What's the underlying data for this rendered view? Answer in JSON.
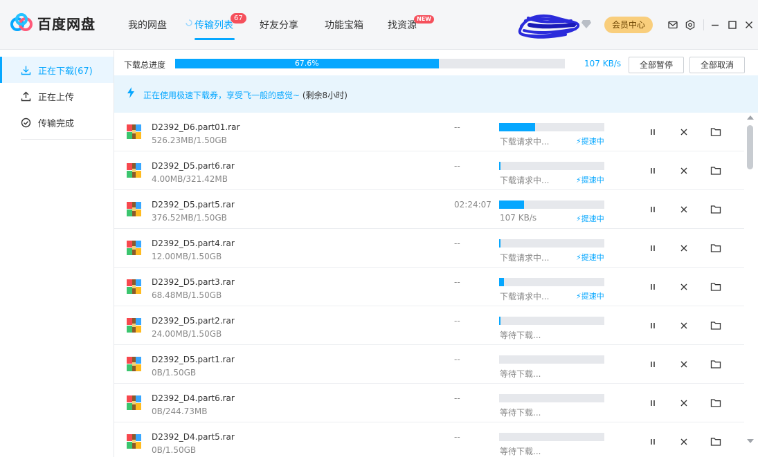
{
  "app": {
    "brand": "百度网盘",
    "colors": {
      "accent": "#06a7ff",
      "badge": "#f5505c",
      "vip": "#f9ce7c"
    }
  },
  "nav": {
    "items": [
      {
        "label": "我的网盘"
      },
      {
        "label": "传输列表",
        "badge": "67"
      },
      {
        "label": "好友分享"
      },
      {
        "label": "功能宝箱"
      },
      {
        "label": "找资源",
        "badge": "NEW"
      }
    ]
  },
  "header": {
    "vip_label": "会员中心"
  },
  "sidebar": {
    "items": [
      {
        "label": "正在下载(67)",
        "icon": "download-icon"
      },
      {
        "label": "正在上传",
        "icon": "upload-icon"
      },
      {
        "label": "传输完成",
        "icon": "check-circle-icon"
      }
    ]
  },
  "total": {
    "label": "下载总进度",
    "percent_text": "67.6%",
    "progress": 0.676,
    "speed": "107 KB/s",
    "pause_all": "全部暂停",
    "cancel_all": "全部取消"
  },
  "notice": {
    "text": "正在使用极速下载券，享受飞一般的感觉~",
    "remaining": " (剩余8小时)"
  },
  "downloads": [
    {
      "name": "D2392_D6.part01.rar",
      "size": "526.23MB/1.50GB",
      "eta": "--",
      "progress": 0.34,
      "status": "下载请求中...",
      "boost": "提速中"
    },
    {
      "name": "D2392_D5.part6.rar",
      "size": "4.00MB/321.42MB",
      "eta": "--",
      "progress": 0.012,
      "status": "下载请求中...",
      "boost": "提速中"
    },
    {
      "name": "D2392_D5.part5.rar",
      "size": "376.52MB/1.50GB",
      "eta": "02:24:07",
      "progress": 0.24,
      "status": "107 KB/s",
      "boost": "提速中"
    },
    {
      "name": "D2392_D5.part4.rar",
      "size": "12.00MB/1.50GB",
      "eta": "--",
      "progress": 0.008,
      "status": "下载请求中...",
      "boost": "提速中"
    },
    {
      "name": "D2392_D5.part3.rar",
      "size": "68.48MB/1.50GB",
      "eta": "--",
      "progress": 0.045,
      "status": "下载请求中...",
      "boost": "提速中"
    },
    {
      "name": "D2392_D5.part2.rar",
      "size": "24.00MB/1.50GB",
      "eta": "--",
      "progress": 0.016,
      "status": "等待下载...",
      "boost": ""
    },
    {
      "name": "D2392_D5.part1.rar",
      "size": "0B/1.50GB",
      "eta": "--",
      "progress": 0,
      "status": "等待下载...",
      "boost": ""
    },
    {
      "name": "D2392_D4.part6.rar",
      "size": "0B/244.73MB",
      "eta": "--",
      "progress": 0,
      "status": "等待下载...",
      "boost": ""
    },
    {
      "name": "D2392_D4.part5.rar",
      "size": "0B/1.50GB",
      "eta": "--",
      "progress": 0,
      "status": "等待下载...",
      "boost": ""
    }
  ]
}
